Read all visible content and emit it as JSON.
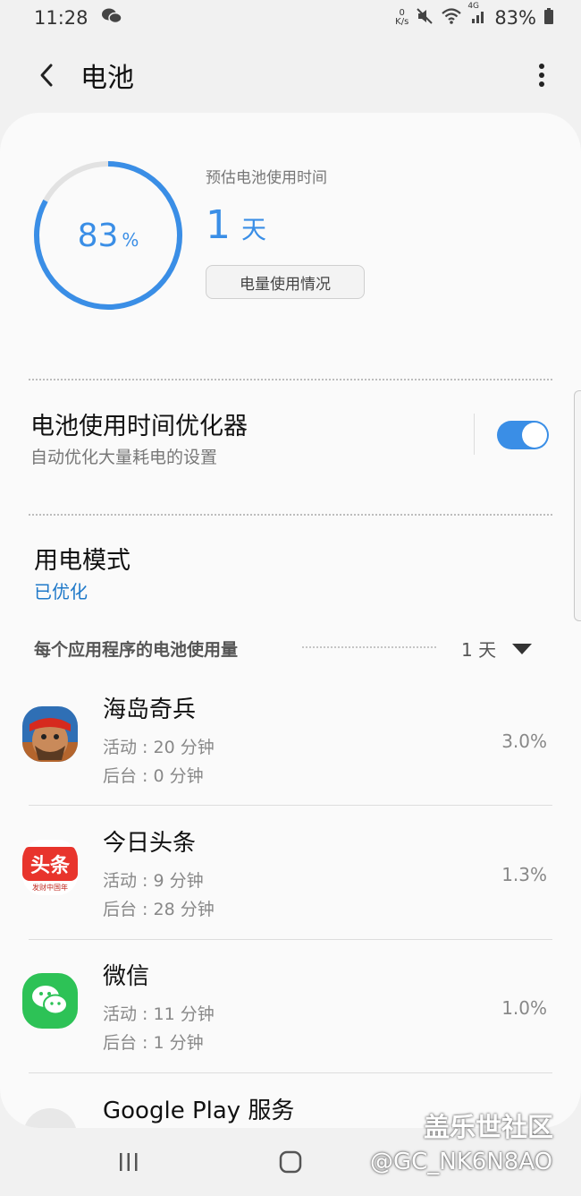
{
  "status_bar": {
    "time": "11:28",
    "net_speed_value": "0",
    "net_speed_unit": "K/s",
    "network": "4G",
    "battery_percent": "83%"
  },
  "app_bar": {
    "title": "电池"
  },
  "battery": {
    "level": 83,
    "level_number": "83",
    "percent_sign": "%",
    "estimate_label": "预估电池使用时间",
    "estimate_value": "1",
    "estimate_unit": "天",
    "usage_button_label": "电量使用情况"
  },
  "optimizer": {
    "title": "电池使用时间优化器",
    "subtitle": "自动优化大量耗电的设置",
    "enabled": true
  },
  "power_mode": {
    "title": "用电模式",
    "value": "已优化"
  },
  "per_app": {
    "label": "每个应用程序的电池使用量",
    "range": "1 天",
    "apps": [
      {
        "name": "海岛奇兵",
        "active": "活动 : 20 分钟",
        "background": "后台 : 0 分钟",
        "percent": "3.0%"
      },
      {
        "name": "今日头条",
        "icon_text": "头条",
        "icon_subtext": "发财中国年",
        "active": "活动 : 9 分钟",
        "background": "后台 : 28 分钟",
        "percent": "1.3%"
      },
      {
        "name": "微信",
        "active": "活动 : 11 分钟",
        "background": "后台 : 1 分钟",
        "percent": "1.0%"
      },
      {
        "name": "Google Play 服务"
      }
    ]
  },
  "watermark": {
    "line1": "盖乐世社区",
    "line2": "@GC_NK6N8AO"
  },
  "colors": {
    "accent": "#3a8ee6",
    "link": "#1f79c9",
    "background": "#f1f1f1",
    "card": "#fafafa"
  }
}
